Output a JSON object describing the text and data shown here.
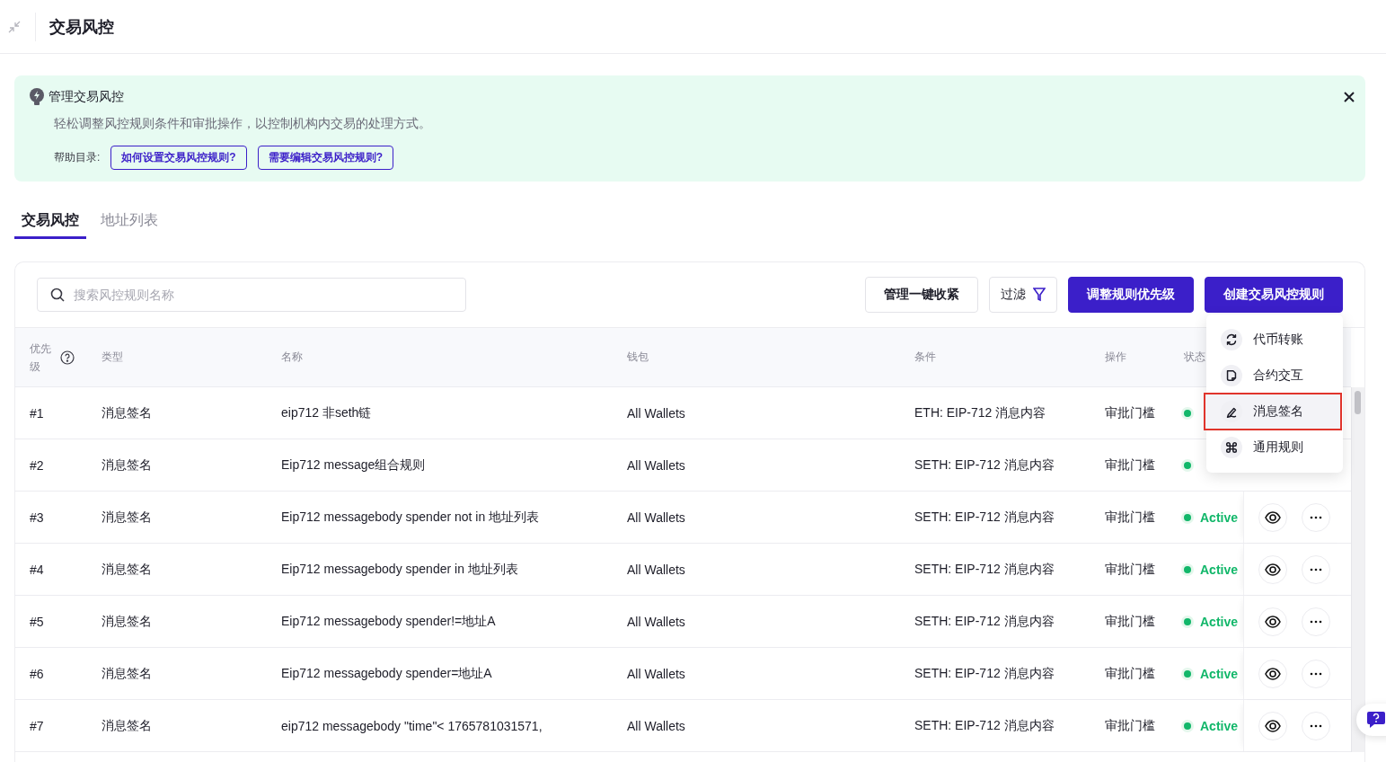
{
  "header": {
    "title": "交易风控"
  },
  "banner": {
    "title": "管理交易风控",
    "description": "轻松调整风控规则条件和审批操作，以控制机构内交易的处理方式。",
    "help_label": "帮助目录:",
    "links": [
      "如何设置交易风控规则?",
      "需要编辑交易风控规则?"
    ]
  },
  "tabs": [
    {
      "label": "交易风控",
      "selected": true
    },
    {
      "label": "地址列表",
      "selected": false
    }
  ],
  "toolbar": {
    "search_placeholder": "搜索风控规则名称",
    "buttons": [
      {
        "label": "管理一键收紧",
        "kind": "outline"
      },
      {
        "label": "过滤",
        "kind": "filter"
      },
      {
        "label": "调整规则优先级",
        "kind": "primary"
      },
      {
        "label": "创建交易风控规则",
        "kind": "primary"
      }
    ]
  },
  "table": {
    "columns": [
      "优先级",
      "类型",
      "名称",
      "钱包",
      "条件",
      "操作",
      "状态"
    ],
    "rows": [
      {
        "priority": "#1",
        "type": "消息签名",
        "name": "eip712 非seth链",
        "wallet": "All Wallets",
        "condition": "ETH: EIP-712 消息内容",
        "action": "审批门槛"
      },
      {
        "priority": "#2",
        "type": "消息签名",
        "name": "Eip712 message组合规则",
        "wallet": "All Wallets",
        "condition": "SETH: EIP-712 消息内容",
        "action": "审批门槛"
      },
      {
        "priority": "#3",
        "type": "消息签名",
        "name": "Eip712 messagebody spender not in 地址列表",
        "wallet": "All Wallets",
        "condition": "SETH: EIP-712 消息内容",
        "action": "审批门槛",
        "status": "Active"
      },
      {
        "priority": "#4",
        "type": "消息签名",
        "name": "Eip712 messagebody spender in 地址列表",
        "wallet": "All Wallets",
        "condition": "SETH: EIP-712 消息内容",
        "action": "审批门槛",
        "status": "Active"
      },
      {
        "priority": "#5",
        "type": "消息签名",
        "name": "Eip712 messagebody spender!=地址A",
        "wallet": "All Wallets",
        "condition": "SETH: EIP-712 消息内容",
        "action": "审批门槛",
        "status": "Active"
      },
      {
        "priority": "#6",
        "type": "消息签名",
        "name": "Eip712 messagebody spender=地址A",
        "wallet": "All Wallets",
        "condition": "SETH: EIP-712 消息内容",
        "action": "审批门槛",
        "status": "Active"
      },
      {
        "priority": "#7",
        "type": "消息签名",
        "name": "eip712 messagebody \"time\"< 1765781031571,",
        "wallet": "All Wallets",
        "condition": "SETH: EIP-712 消息内容",
        "action": "审批门槛",
        "status": "Active"
      }
    ]
  },
  "dropdown": {
    "items": [
      {
        "label": "代币转账",
        "kind": "transfer",
        "selected": false
      },
      {
        "label": "合约交互",
        "kind": "contract",
        "selected": false
      },
      {
        "label": "消息签名",
        "kind": "signature",
        "selected": true
      },
      {
        "label": "通用规则",
        "kind": "general",
        "selected": false
      }
    ]
  }
}
